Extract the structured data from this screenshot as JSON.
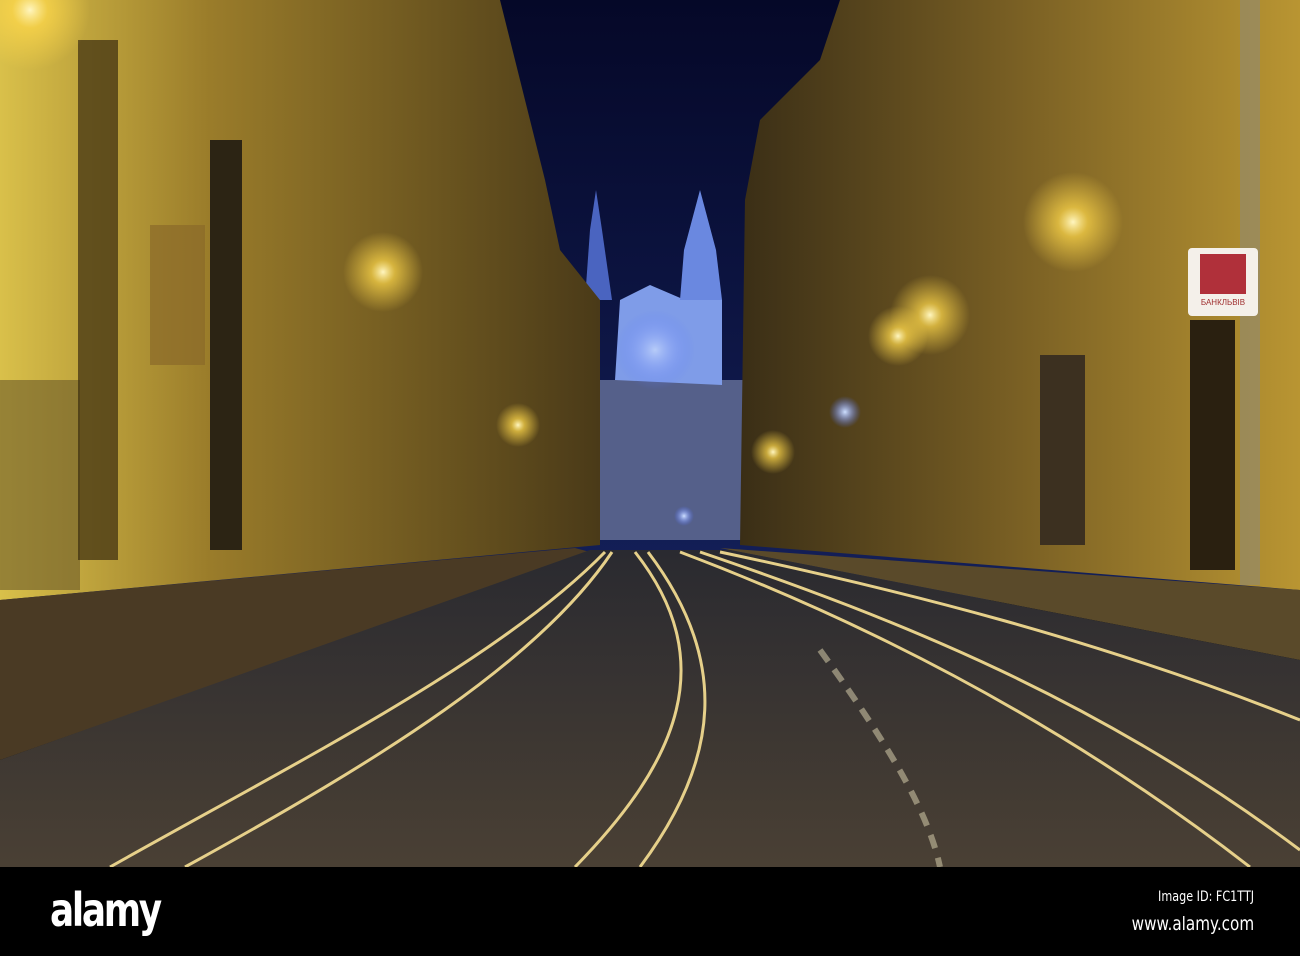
{
  "photo": {
    "subject": "night street with tram tracks and illuminated church",
    "sign_text": "БАНКЛЬВІВ",
    "colors": {
      "sky": "#0a0f3a",
      "building_light": "#d8b43a",
      "building_dark": "#3a2e18",
      "road": "#3b3630",
      "rail": "#e6d08a",
      "church": "#8fb0ff"
    }
  },
  "watermark": {
    "brand": "alamy",
    "image_id": "Image ID: FC1TTJ",
    "url": "www.alamy.com"
  }
}
